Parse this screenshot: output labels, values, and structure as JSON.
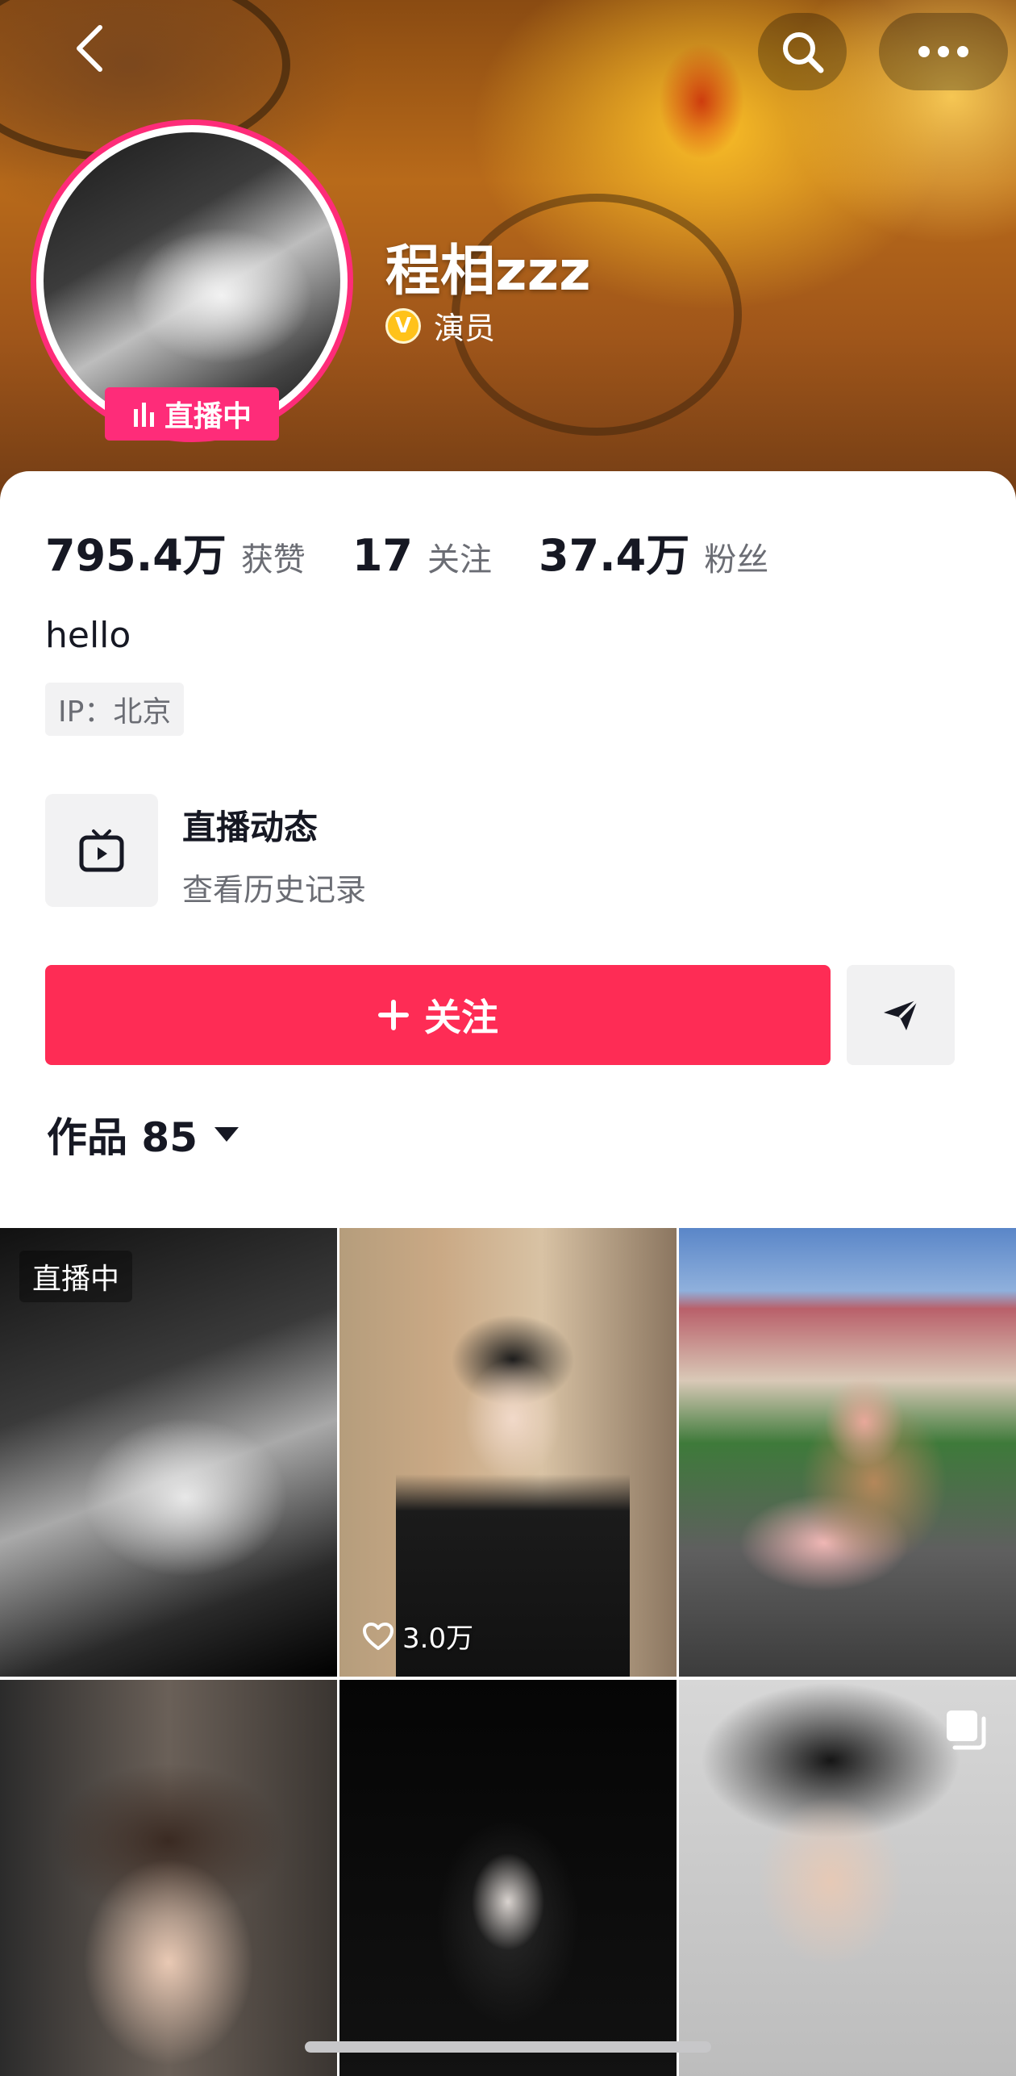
{
  "header": {
    "user_name": "程相zzz",
    "verified_title": "演员",
    "live_badge": "直播中",
    "icons": {
      "back": "chevron-left-icon",
      "search": "search-icon",
      "more": "more-dots-icon"
    }
  },
  "stats": [
    {
      "value": "795.4万",
      "label": "获赞"
    },
    {
      "value": "17",
      "label": "关注"
    },
    {
      "value": "37.4万",
      "label": "粉丝"
    }
  ],
  "bio": "hello",
  "ip_location": "IP：北京",
  "live_history": {
    "title": "直播动态",
    "subtitle": "查看历史记录",
    "icon": "tv-icon"
  },
  "actions": {
    "follow_label": "关注",
    "share_icon": "send-icon"
  },
  "works_tab": {
    "label": "作品 85"
  },
  "grid": [
    {
      "label": "直播中"
    },
    {
      "likes": "3.0万"
    },
    {},
    {},
    {},
    {
      "icon": "multi-image-icon"
    }
  ],
  "colors": {
    "accent": "#fe2c55",
    "live_pink": "#fe2c79",
    "verify_gold": "#ffc21a"
  }
}
